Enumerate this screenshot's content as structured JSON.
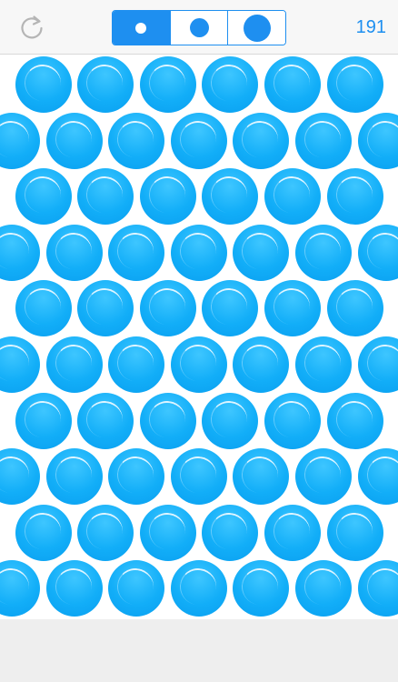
{
  "toolbar": {
    "reset_icon": "refresh-arrow-icon",
    "size_options": [
      {
        "name": "small",
        "selected": true
      },
      {
        "name": "medium",
        "selected": false
      },
      {
        "name": "large",
        "selected": false
      }
    ],
    "score": "191"
  },
  "board": {
    "rows": 10,
    "even_row_bubbles": 6,
    "odd_row_bubbles": 7
  },
  "colors": {
    "accent": "#1e8ff0",
    "bubble": "#12aef8",
    "toolbar_bg": "#f7f7f7",
    "footer_bg": "#eeeeee"
  }
}
